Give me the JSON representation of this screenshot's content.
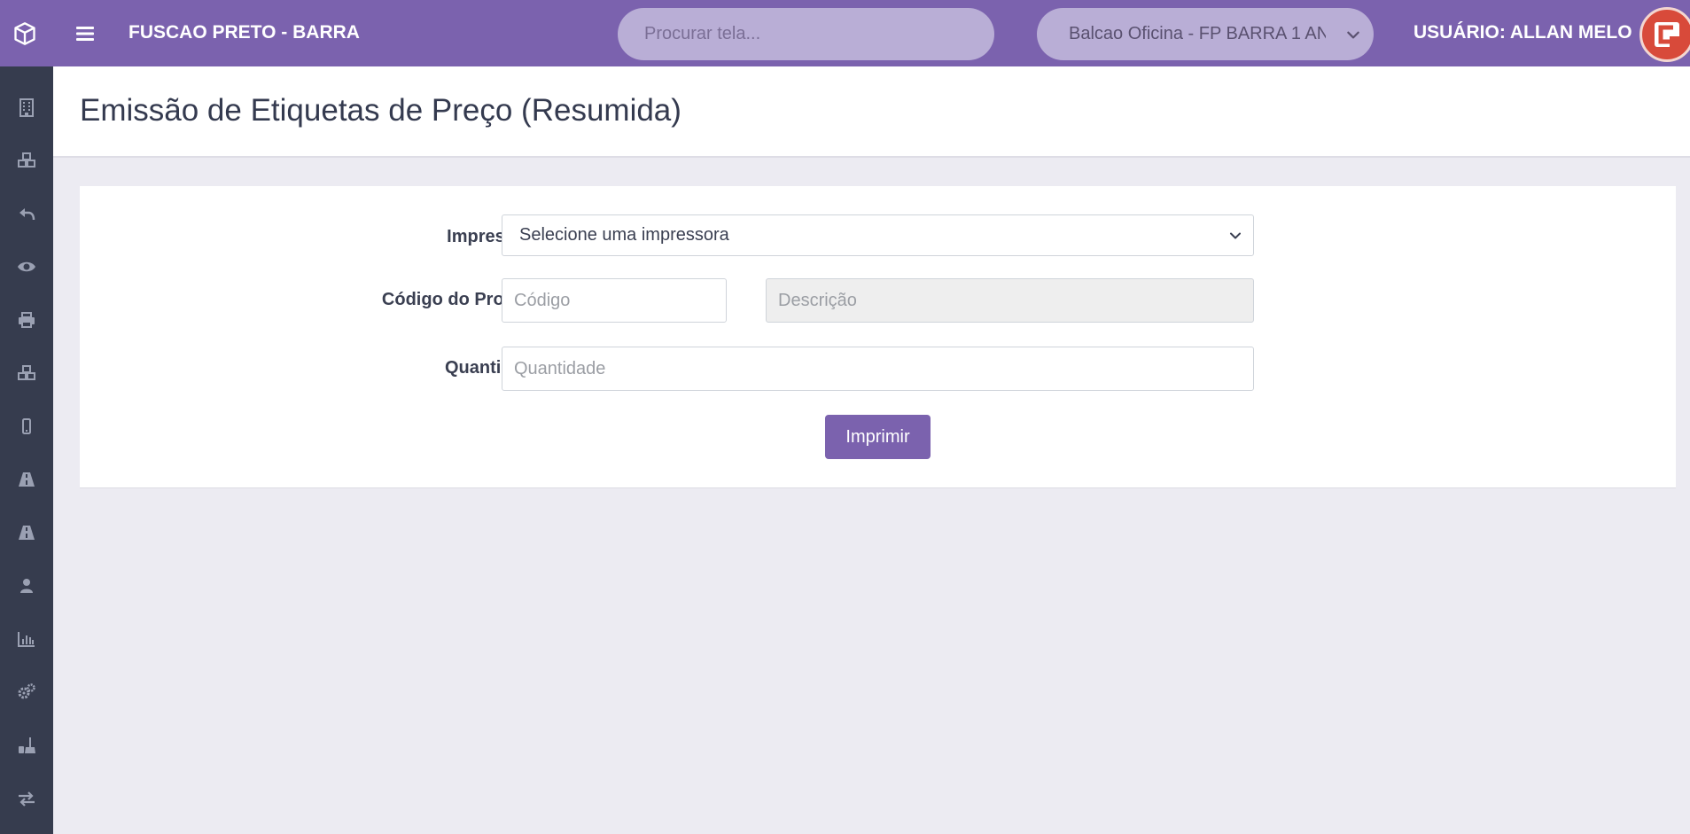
{
  "header": {
    "company": "FUSCAO PRETO - BARRA",
    "search_placeholder": "Procurar tela...",
    "branch": "Balcao Oficina - FP BARRA 1 AN",
    "user": "USUÁRIO: ALLAN MELO"
  },
  "sidebar": {
    "items": [
      {
        "icon": "building-icon"
      },
      {
        "icon": "cubes-icon"
      },
      {
        "icon": "reply-icon"
      },
      {
        "icon": "eye-icon"
      },
      {
        "icon": "print-icon"
      },
      {
        "icon": "cubes-icon"
      },
      {
        "icon": "mobile-icon"
      },
      {
        "icon": "road-icon"
      },
      {
        "icon": "road-icon"
      },
      {
        "icon": "user-icon"
      },
      {
        "icon": "bar-chart-icon"
      },
      {
        "icon": "gears-icon"
      },
      {
        "icon": "broom-icon"
      },
      {
        "icon": "exchange-icon"
      }
    ]
  },
  "page": {
    "title": "Emissão de Etiquetas de Preço (Resumida)"
  },
  "form": {
    "printer_label": "Impressora",
    "printer_selected": "Selecione uma impressora",
    "product_code_label": "Código do Produto",
    "code_placeholder": "Código",
    "description_placeholder": "Descrição",
    "quantity_label": "Quantidade",
    "quantity_placeholder": "Quantidade",
    "print_button": "Imprimir"
  },
  "colors": {
    "accent": "#7b62ae",
    "sidebar": "#363c4e",
    "background": "#ecebf2"
  }
}
